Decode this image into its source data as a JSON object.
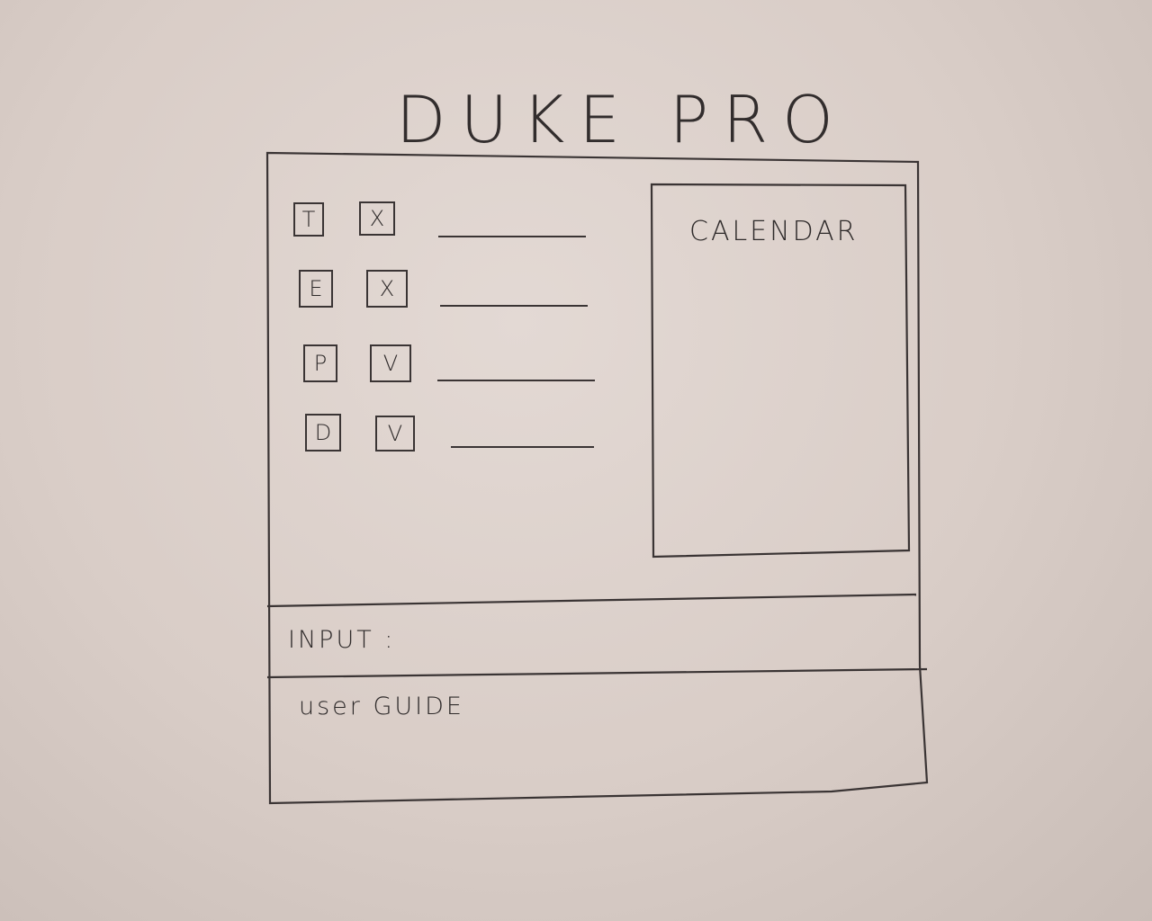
{
  "app": {
    "title": "DUKE PRO"
  },
  "tasks": [
    {
      "type": "T",
      "status": "X",
      "description": ""
    },
    {
      "type": "E",
      "status": "X",
      "description": ""
    },
    {
      "type": "P",
      "status": "V",
      "description": ""
    },
    {
      "type": "D",
      "status": "V",
      "description": ""
    }
  ],
  "calendar": {
    "label": "CALENDAR"
  },
  "input": {
    "label": "INPUT :",
    "value": "",
    "placeholder": ""
  },
  "guide": {
    "label": "user GUIDE"
  }
}
